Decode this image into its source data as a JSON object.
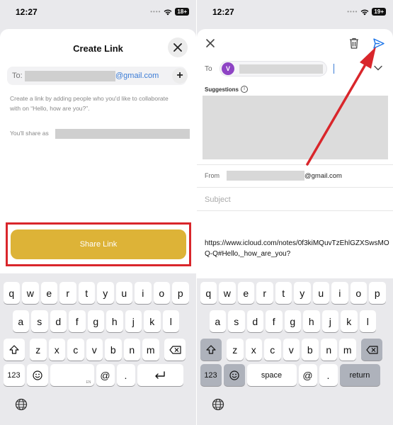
{
  "left": {
    "status": {
      "time": "12:27",
      "badge": "18+"
    },
    "sheet": {
      "title": "Create Link",
      "to_label": "To:",
      "to_email_suffix": "@gmail.com",
      "description": "Create a link by adding people who you'd like to collaborate with on “Hello, how are you?”.",
      "share_as_label": "You'll share as",
      "share_button": "Share Link"
    },
    "keyboard": {
      "row1": [
        "q",
        "w",
        "e",
        "r",
        "t",
        "y",
        "u",
        "i",
        "o",
        "p"
      ],
      "row2": [
        "a",
        "s",
        "d",
        "f",
        "g",
        "h",
        "j",
        "k",
        "l"
      ],
      "row3": [
        "z",
        "x",
        "c",
        "v",
        "b",
        "n",
        "m"
      ],
      "num_key": "123",
      "at_key": "@",
      "dot_key": ".",
      "space_hint": "EN"
    }
  },
  "right": {
    "status": {
      "time": "12:27",
      "badge": "19+"
    },
    "compose": {
      "to_label": "To",
      "avatar_initial": "V",
      "suggestions_label": "Suggestions",
      "from_label": "From",
      "from_email_suffix": "@gmail.com",
      "subject_placeholder": "Subject",
      "body": "https://www.icloud.com/notes/0f3kiMQuvTzEhlGZXSwsMOQ-Q#Hello,_how_are_you?"
    },
    "keyboard": {
      "row1": [
        "q",
        "w",
        "e",
        "r",
        "t",
        "y",
        "u",
        "i",
        "o",
        "p"
      ],
      "row2": [
        "a",
        "s",
        "d",
        "f",
        "g",
        "h",
        "j",
        "k",
        "l"
      ],
      "row3": [
        "z",
        "x",
        "c",
        "v",
        "b",
        "n",
        "m"
      ],
      "num_key": "123",
      "space_key": "space",
      "at_key": "@",
      "dot_key": ".",
      "return_key": "return"
    }
  },
  "colors": {
    "share_button": "#ddb337",
    "highlight": "#d9262b",
    "arrow": "#d9262b",
    "link_blue": "#3a7bd5",
    "avatar": "#8e44c4"
  }
}
